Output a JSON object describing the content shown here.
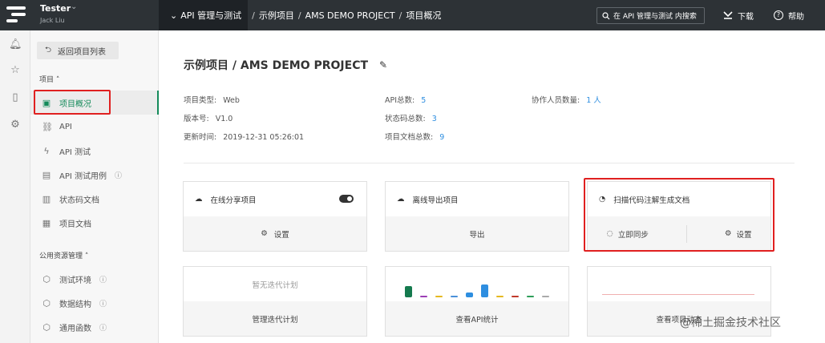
{
  "app": {
    "user_name": "Tester",
    "user_sub": "Jack Liu"
  },
  "breadcrumb": {
    "current": "API 管理与测试",
    "p2": "示例项目",
    "p3": "AMS DEMO PROJECT",
    "p4": "项目概况"
  },
  "search": {
    "placeholder": "在 API 管理与测试 内搜索"
  },
  "topbar": {
    "download": "下载",
    "help": "帮助"
  },
  "sidebar": {
    "back": "返回项目列表",
    "section_project": "项目",
    "items": [
      "项目概况",
      "API",
      "API 测试",
      "API 测试用例",
      "状态码文档",
      "项目文档"
    ],
    "section_public": "公用资源管理",
    "public_items": [
      "测试环境",
      "数据结构",
      "通用函数"
    ]
  },
  "page": {
    "title": "示例项目 / AMS DEMO PROJECT",
    "info": {
      "type_label": "项目类型:",
      "type_value": "Web",
      "version_label": "版本号:",
      "version_value": "V1.0",
      "updated_label": "更新时间:",
      "updated_value": "2019-12-31 05:26:01",
      "api_total_label": "API总数:",
      "api_total_value": "5",
      "status_total_label": "状态码总数:",
      "status_total_value": "3",
      "docs_total_label": "项目文档总数:",
      "docs_total_value": "9",
      "members_label": "协作人员数量:",
      "members_value": "1 人"
    }
  },
  "cards": {
    "share": {
      "title": "在线分享项目",
      "footer": "设置"
    },
    "export": {
      "title": "离线导出项目",
      "footer": "导出"
    },
    "scan": {
      "title": "扫描代码注解生成文档",
      "sync": "立即同步",
      "settings": "设置"
    },
    "iter": {
      "empty": "暂无迭代计划",
      "footer": "管理迭代计划"
    },
    "api_stats": {
      "footer": "查看API统计"
    },
    "dynamics": {
      "footer": "查看项目动态"
    }
  },
  "api_stats_bars": [
    {
      "color": "#157a4e",
      "level": 0.9
    },
    {
      "color": "#9b3fb5",
      "level": 0.12
    },
    {
      "color": "#e6b820",
      "level": 0.12
    },
    {
      "color": "#4a90d9",
      "level": 0.12
    },
    {
      "color": "#2e8ee0",
      "level": 0.35
    },
    {
      "color": "#2e8ee0",
      "level": 1.0
    },
    {
      "color": "#e6b820",
      "level": 0.12
    },
    {
      "color": "#c0392b",
      "level": 0.12
    },
    {
      "color": "#2e9e5a",
      "level": 0.12
    },
    {
      "color": "#aaaaaa",
      "level": 0.12
    }
  ],
  "watermark": "@稀土掘金技术社区"
}
